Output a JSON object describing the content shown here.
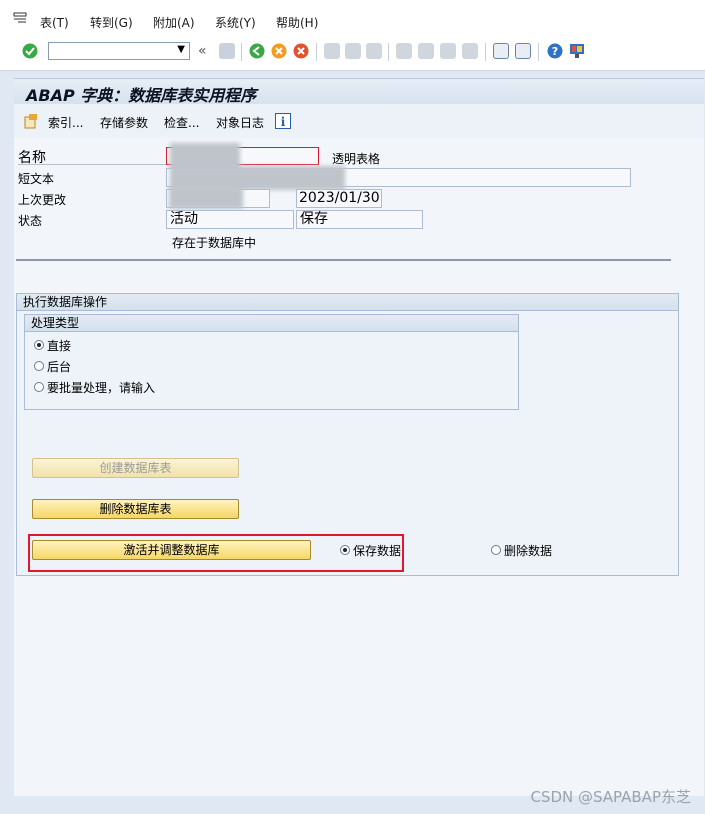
{
  "menu": {
    "items": [
      "表(T)",
      "转到(G)",
      "附加(A)",
      "系统(Y)",
      "帮助(H)"
    ]
  },
  "toolbar": {
    "command_field_value": "",
    "icons": [
      "enter-icon",
      "dropdown-icon",
      "double-left-icon",
      "save-icon",
      "back-icon",
      "exit-icon",
      "cancel-icon",
      "print-icon",
      "find-icon",
      "find-next-icon",
      "first-page-icon",
      "prev-page-icon",
      "next-page-icon",
      "last-page-icon",
      "new-session-icon",
      "shortcut-icon",
      "help-icon",
      "layout-icon"
    ]
  },
  "header": {
    "title": "ABAP 字典：数据库表实用程序"
  },
  "app_toolbar": {
    "index": "索引...",
    "storage": "存储参数",
    "check": "检查...",
    "object_log": "对象日志"
  },
  "form": {
    "name_label": "名称",
    "name_type": "透明表格",
    "short_text_label": "短文本",
    "last_changed_label": "上次更改",
    "last_changed_date": "2023/01/30",
    "status_label": "状态",
    "status_value1": "活动",
    "status_value2": "保存",
    "status_note": "存在于数据库中"
  },
  "db_ops": {
    "group_title": "执行数据库操作",
    "proc_title": "处理类型",
    "options": [
      "直接",
      "后台",
      "要批量处理，请输入"
    ],
    "selected": 0,
    "create_btn": "创建数据库表",
    "delete_btn": "删除数据库表",
    "activate_btn": "激活并调整数据库",
    "keep_data": "保存数据",
    "delete_data": "删除数据"
  },
  "colors": {
    "accent_red": "#e0182d",
    "button_yellow": "#f5d766"
  },
  "watermark": "CSDN @SAPABAP东芝"
}
